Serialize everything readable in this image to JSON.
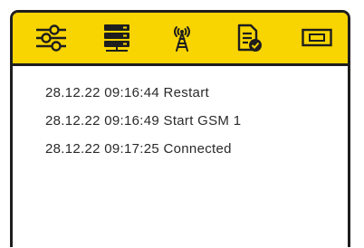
{
  "colors": {
    "toolbar_bg": "#f8d400",
    "border": "#1e1e1e",
    "text": "#2a2a2a"
  },
  "toolbar": {
    "buttons": [
      {
        "icon": "settings-sliders-icon"
      },
      {
        "icon": "server-icon"
      },
      {
        "icon": "antenna-tower-icon"
      },
      {
        "icon": "document-check-icon"
      },
      {
        "icon": "window-icon"
      }
    ]
  },
  "log": {
    "lines": [
      "28.12.22 09:16:44 Restart",
      "28.12.22 09:16:49 Start GSM 1",
      "28.12.22 09:17:25 Connected"
    ]
  }
}
